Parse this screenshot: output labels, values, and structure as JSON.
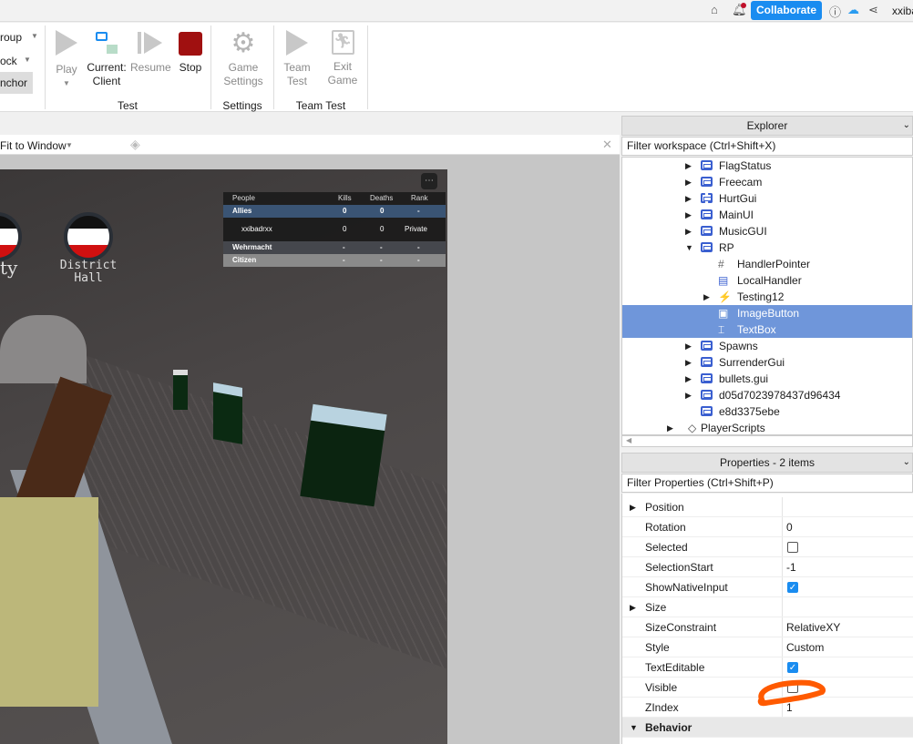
{
  "topbar": {
    "collaborate": "Collaborate",
    "user": "xxiba"
  },
  "ribbon": {
    "left_items": [
      "roup",
      "ock",
      "nchor"
    ],
    "buttons": {
      "play": "Play",
      "current": "Current:",
      "client": "Client",
      "resume": "Resume",
      "stop": "Stop",
      "game": "Game",
      "settings": "Settings",
      "team": "Team",
      "test": "Test",
      "exit": "Exit",
      "exit_game": "Game"
    },
    "groups": {
      "test": "Test",
      "settings": "Settings",
      "team_test": "Team Test"
    }
  },
  "viewport": {
    "zoom": "Fit to Window"
  },
  "game": {
    "signs": [
      "ty",
      "District",
      "Hall"
    ],
    "leaderboard": {
      "headers": [
        "People",
        "Kills",
        "Deaths",
        "Rank"
      ],
      "rows": [
        {
          "name": "Allies",
          "kills": "0",
          "deaths": "0",
          "rank": "-"
        },
        {
          "name": "xxibadrxx",
          "kills": "0",
          "deaths": "0",
          "rank": "Private"
        },
        {
          "name": "Wehrmacht",
          "kills": "-",
          "deaths": "-",
          "rank": "-"
        },
        {
          "name": "Citizen",
          "kills": "-",
          "deaths": "-",
          "rank": "-"
        }
      ]
    }
  },
  "explorer": {
    "title": "Explorer",
    "filter": "Filter workspace (Ctrl+Shift+X)",
    "items": [
      "FlagStatus",
      "Freecam",
      "HurtGui",
      "MainUI",
      "MusicGUI",
      "RP",
      "HandlerPointer",
      "LocalHandler",
      "Testing12",
      "ImageButton",
      "TextBox",
      "Spawns",
      "SurrenderGui",
      "bullets.gui",
      "d05d7023978437d96434",
      "e8d3375ebe",
      "PlayerScripts"
    ]
  },
  "properties": {
    "title": "Properties - 2 items",
    "filter": "Filter Properties (Ctrl+Shift+P)",
    "rows": [
      {
        "name": "Position",
        "value": ""
      },
      {
        "name": "Rotation",
        "value": "0"
      },
      {
        "name": "Selected",
        "value": "false"
      },
      {
        "name": "SelectionStart",
        "value": "-1"
      },
      {
        "name": "ShowNativeInput",
        "value": "true"
      },
      {
        "name": "Size",
        "value": ""
      },
      {
        "name": "SizeConstraint",
        "value": "RelativeXY"
      },
      {
        "name": "Style",
        "value": "Custom"
      },
      {
        "name": "TextEditable",
        "value": "true"
      },
      {
        "name": "Visible",
        "value": "false"
      },
      {
        "name": "ZIndex",
        "value": "1"
      }
    ],
    "section": "Behavior"
  },
  "colors": {
    "accent": "#1a8cf0",
    "selection": "#6f96da",
    "stop": "#a01010",
    "annotation": "#ff5a00"
  }
}
